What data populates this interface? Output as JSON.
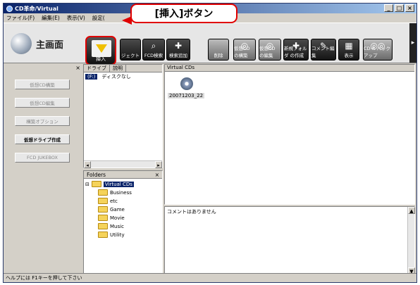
{
  "window": {
    "title": "CD革命/Virtual",
    "minimize": "_",
    "maximize": "□",
    "close": "×"
  },
  "menu": [
    "ファイル(F)",
    "編集(E)",
    "表示(V)",
    "設定("
  ],
  "toolbar": {
    "home_label": "主画面",
    "buttons": [
      {
        "label": "挿入"
      },
      {
        "label": "ジェクト"
      },
      {
        "label": "FCD検索"
      },
      {
        "label": "検索追加"
      },
      {
        "label": "削除"
      },
      {
        "label": "仮想CD の構築"
      },
      {
        "label": "仮想CD の編集"
      },
      {
        "label": "新規フォルダ の作成"
      },
      {
        "label": "コメント編集"
      },
      {
        "label": "表示"
      },
      {
        "label": "CD-R バックアップ"
      }
    ],
    "scroll_right": "▸"
  },
  "callout": {
    "text": "[挿入]ボタン"
  },
  "left_pane": {
    "close": "×",
    "buttons": [
      {
        "label": "仮想CD構築",
        "enabled": false
      },
      {
        "label": "仮想CD編集",
        "enabled": false
      },
      {
        "label": "構築オプション",
        "enabled": false
      },
      {
        "label": "仮想ドライブ作成",
        "enabled": true
      },
      {
        "label": "FCD JUKEBOX",
        "enabled": false
      }
    ]
  },
  "drive_list": {
    "headers": [
      "ドライブ",
      "説明"
    ],
    "rows": [
      {
        "drive": "(F:)",
        "description": "ディスクなし"
      }
    ],
    "left_arrow": "◂",
    "right_arrow": "▸"
  },
  "folders": {
    "title": "Folders",
    "close": "×",
    "root": "Virtual CDs",
    "expand": "⊟",
    "children": [
      "Business",
      "etc",
      "Game",
      "Movie",
      "Music",
      "Utility"
    ]
  },
  "virtual_cds": {
    "header": "Virtual CDs",
    "items": [
      {
        "name": "20071203_22"
      }
    ]
  },
  "comment": {
    "text": "コメントはありません",
    "up": "▲",
    "down": "▼"
  },
  "status": {
    "text": "ヘルプには F1キーを押して下さい"
  }
}
